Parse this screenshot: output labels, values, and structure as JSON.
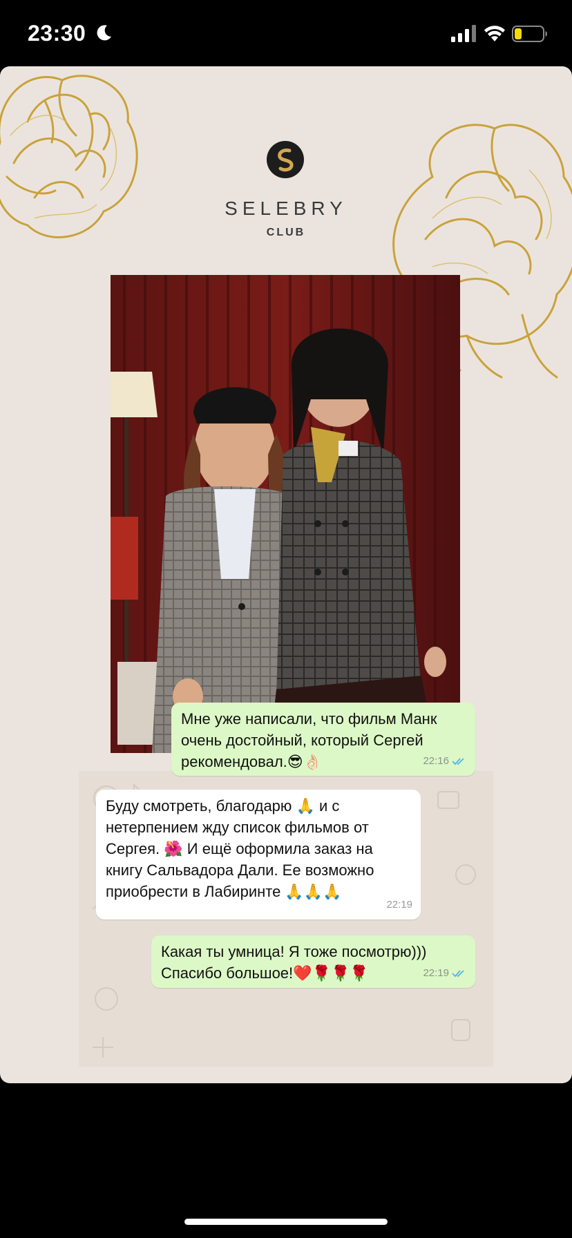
{
  "status_bar": {
    "time": "23:30",
    "icons": [
      "moon-icon",
      "signal-icon",
      "wifi-icon",
      "battery-icon"
    ],
    "battery_color": "#f5d90a"
  },
  "story": {
    "brand_name": "SELEBRY",
    "brand_sub": "CLUB",
    "accent_gold": "#c9a23a",
    "background": "#ebe4de"
  },
  "chat": {
    "messages": [
      {
        "direction": "outgoing",
        "text": "Мне уже написали, что фильм Манк\nочень достойный, который Сергей\nрекомендовал.😎👌🏻",
        "time": "22:16",
        "read": true
      },
      {
        "direction": "incoming",
        "text": "Буду смотреть, благодарю 🙏 и с\nнетерпением жду список фильмов от\nСергея. 🌺 И ещё оформила заказ на\nкнигу Сальвадора Дали. Ее возможно\nприобрести в Лабиринте 🙏🙏🙏",
        "time": "22:19"
      },
      {
        "direction": "outgoing",
        "text": "Какая ты умница! Я тоже посмотрю)))\nСпасибо большое!❤️🌹🌹🌹",
        "time": "22:19",
        "read": true
      }
    ],
    "outgoing_color": "#dcf8c6",
    "incoming_color": "#ffffff",
    "tick_color": "#4fb6ec"
  }
}
